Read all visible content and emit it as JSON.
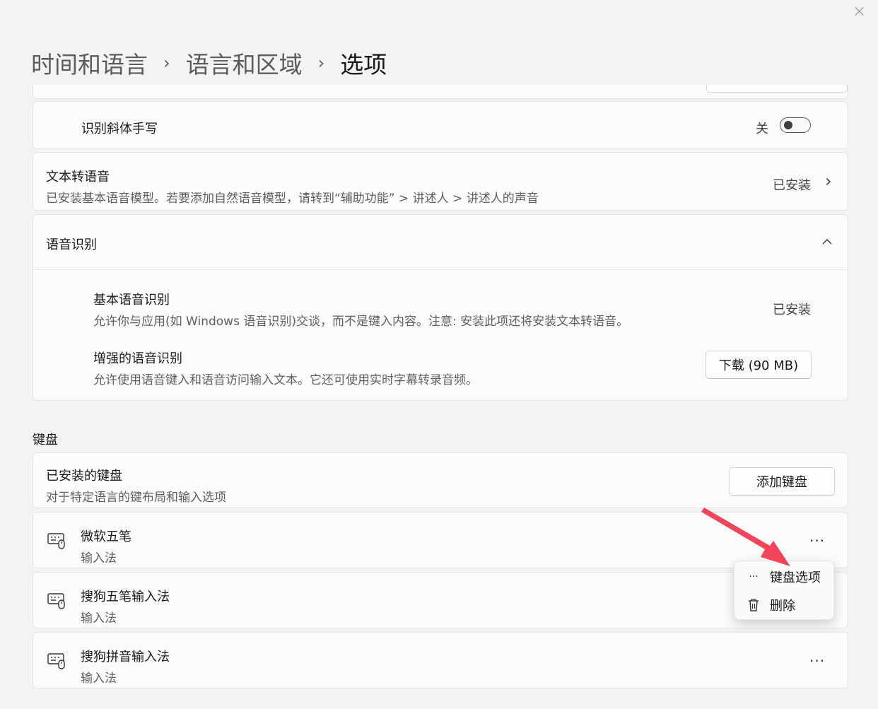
{
  "breadcrumb": {
    "level1": "时间和语言",
    "level2": "语言和区域",
    "current": "选项",
    "separator": "›"
  },
  "handwriting": {
    "italic_label": "识别斜体手写",
    "toggle_state": "关"
  },
  "tts": {
    "title": "文本转语音",
    "description": "已安装基本语音模型。若要添加自然语音模型，请转到“辅助功能” > 讲述人 > 讲述人的声音",
    "status": "已安装",
    "chevron": "›"
  },
  "speech": {
    "title": "语音识别",
    "basic_title": "基本语音识别",
    "basic_desc": "允许你与应用(如 Windows 语音识别)交谈，而不是键入内容。注意: 安装此项还将安装文本转语音。",
    "basic_status": "已安装",
    "enhanced_title": "增强的语音识别",
    "enhanced_desc": "允许使用语音键入和语音访问输入文本。它还可使用实时字幕转录音频。",
    "download_label": "下载 (90 MB)"
  },
  "keyboard": {
    "section_label": "键盘",
    "installed_title": "已安装的键盘",
    "installed_desc": "对于特定语言的键布局和输入选项",
    "add_label": "添加键盘",
    "items": [
      {
        "name": "微软五笔",
        "type": "输入法"
      },
      {
        "name": "搜狗五笔输入法",
        "type": "输入法"
      },
      {
        "name": "搜狗拼音输入法",
        "type": "输入法"
      }
    ],
    "more_glyph": "···"
  },
  "context_menu": {
    "options_label": "键盘选项",
    "delete_label": "删除",
    "options_glyph": "···"
  },
  "colors": {
    "arrow": "#f2455a"
  }
}
